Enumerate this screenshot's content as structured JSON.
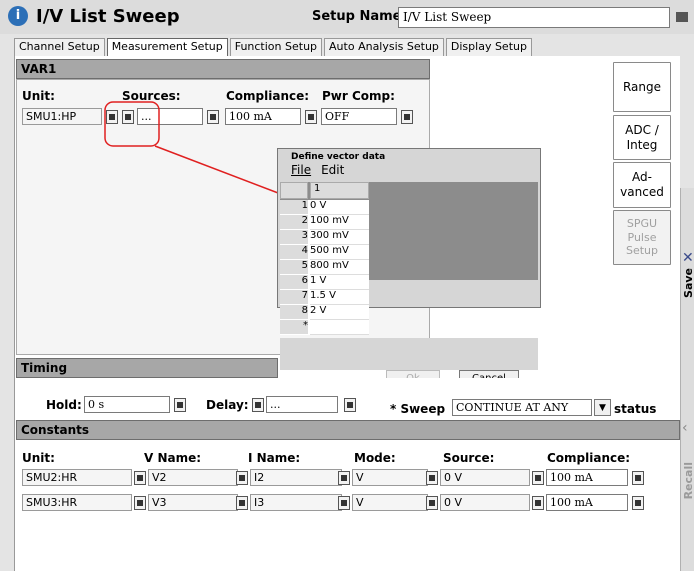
{
  "header": {
    "title": "I/V List Sweep",
    "setup_name_label": "Setup Name:",
    "setup_name_value": "I/V List Sweep"
  },
  "tabs": [
    {
      "label": "Channel Setup"
    },
    {
      "label": "Measurement Setup"
    },
    {
      "label": "Function Setup"
    },
    {
      "label": "Auto Analysis Setup"
    },
    {
      "label": "Display Setup"
    }
  ],
  "var1": {
    "title": "VAR1",
    "unit_label": "Unit:",
    "sources_label": "Sources:",
    "compliance_label": "Compliance:",
    "pwr_comp_label": "Pwr Comp:",
    "unit_value": "SMU1:HP",
    "sources_value": "...",
    "compliance_value": "100 mA",
    "pwr_comp_value": "OFF"
  },
  "right_buttons": {
    "range": "Range",
    "adc": "ADC /\nInteg",
    "advanced": "Ad-\nvanced",
    "spgu": "SPGU\nPulse\nSetup"
  },
  "sidebar": {
    "save": "Save",
    "recall": "Recall"
  },
  "dialog": {
    "title": "Define vector data",
    "menu_file": "File",
    "menu_edit": "Edit",
    "column_header": "1",
    "rows": [
      {
        "n": "1",
        "v": "0 V"
      },
      {
        "n": "2",
        "v": "100 mV"
      },
      {
        "n": "3",
        "v": "300 mV"
      },
      {
        "n": "4",
        "v": "500 mV"
      },
      {
        "n": "5",
        "v": "800 mV"
      },
      {
        "n": "6",
        "v": "1 V"
      },
      {
        "n": "7",
        "v": "1.5 V"
      },
      {
        "n": "8",
        "v": "2 V"
      },
      {
        "n": "*",
        "v": ""
      }
    ],
    "ok": "Ok",
    "cancel": "Cancel"
  },
  "timing": {
    "title": "Timing",
    "hold_label": "Hold:",
    "hold_value": "0 s",
    "delay_label": "Delay:",
    "delay_value": "...",
    "sweep_label": "* Sweep",
    "sweep_value": "CONTINUE AT ANY",
    "status_label": "status"
  },
  "constants": {
    "title": "Constants",
    "headers": {
      "unit": "Unit:",
      "vname": "V Name:",
      "iname": "I Name:",
      "mode": "Mode:",
      "source": "Source:",
      "compliance": "Compliance:"
    },
    "rows": [
      {
        "unit": "SMU2:HR",
        "vname": "V2",
        "iname": "I2",
        "mode": "V",
        "source": "0 V",
        "compliance": "100 mA"
      },
      {
        "unit": "SMU3:HR",
        "vname": "V3",
        "iname": "I3",
        "mode": "V",
        "source": "0 V",
        "compliance": "100 mA"
      }
    ]
  },
  "colors": {
    "annotation": "#e02020",
    "accent": "#2c6fb7",
    "section_bar": "#a7a7a7"
  }
}
